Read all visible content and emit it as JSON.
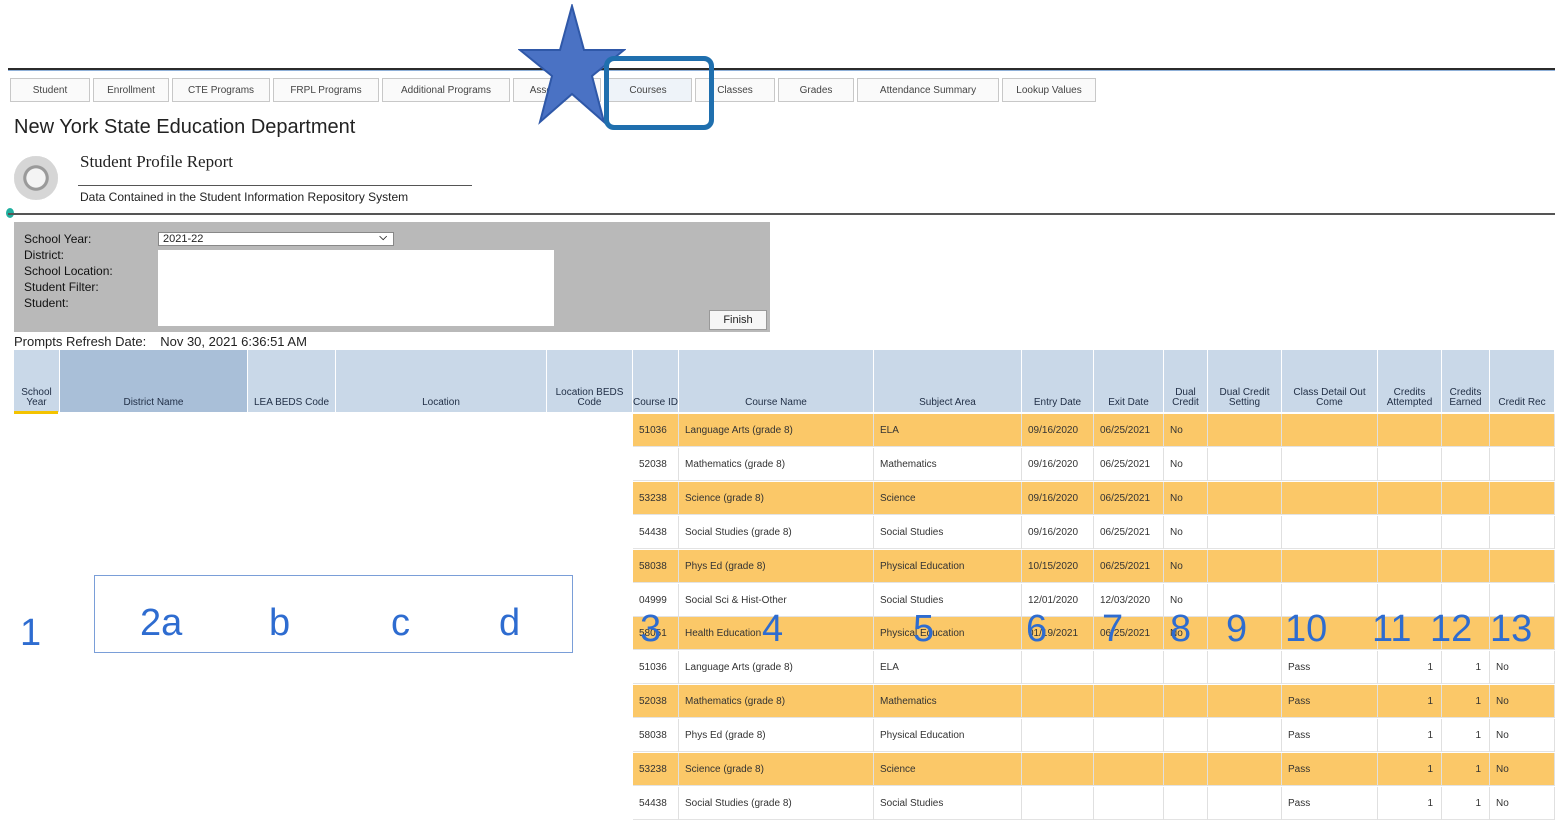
{
  "tabs": [
    "Student",
    "Enrollment",
    "CTE Programs",
    "FRPL Programs",
    "Additional Programs",
    "Assessment",
    "Courses",
    "Classes",
    "Grades",
    "Attendance Summary",
    "Lookup Values"
  ],
  "active_tab": "Courses",
  "org_title": "New York State Education Department",
  "report_title": "Student Profile Report",
  "report_subtitle": "Data Contained in the Student Information Repository System",
  "prompts": {
    "school_year_label": "School Year:",
    "school_year_value": "2021-22",
    "district_label": "District:",
    "school_location_label": "School Location:",
    "student_filter_label": "Student Filter:",
    "student_label": "Student:",
    "finish_label": "Finish"
  },
  "refresh": {
    "label": "Prompts Refresh Date:",
    "value": "Nov 30, 2021 6:36:51 AM"
  },
  "columns": [
    "School Year",
    "District Name",
    "LEA BEDS Code",
    "Location",
    "Location BEDS Code",
    "Course ID",
    "Course Name",
    "Subject Area",
    "Entry Date",
    "Exit Date",
    "Dual Credit",
    "Dual Credit Setting",
    "Class Detail Out Come",
    "Credits Attempted",
    "Credits Earned",
    "Credit Rec"
  ],
  "rows": [
    {
      "course_id": "51036",
      "course_name": "Language Arts (grade 8)",
      "subject": "ELA",
      "entry": "09/16/2020",
      "exit": "06/25/2021",
      "dual": "No",
      "outcome": "",
      "attempted": "",
      "earned": "",
      "rec": ""
    },
    {
      "course_id": "52038",
      "course_name": "Mathematics (grade 8)",
      "subject": "Mathematics",
      "entry": "09/16/2020",
      "exit": "06/25/2021",
      "dual": "No",
      "outcome": "",
      "attempted": "",
      "earned": "",
      "rec": ""
    },
    {
      "course_id": "53238",
      "course_name": "Science (grade 8)",
      "subject": "Science",
      "entry": "09/16/2020",
      "exit": "06/25/2021",
      "dual": "No",
      "outcome": "",
      "attempted": "",
      "earned": "",
      "rec": ""
    },
    {
      "course_id": "54438",
      "course_name": "Social Studies (grade 8)",
      "subject": "Social Studies",
      "entry": "09/16/2020",
      "exit": "06/25/2021",
      "dual": "No",
      "outcome": "",
      "attempted": "",
      "earned": "",
      "rec": ""
    },
    {
      "course_id": "58038",
      "course_name": "Phys Ed (grade 8)",
      "subject": "Physical Education",
      "entry": "10/15/2020",
      "exit": "06/25/2021",
      "dual": "No",
      "outcome": "",
      "attempted": "",
      "earned": "",
      "rec": ""
    },
    {
      "course_id": "04999",
      "course_name": "Social Sci & Hist-Other",
      "subject": "Social Studies",
      "entry": "12/01/2020",
      "exit": "12/03/2020",
      "dual": "No",
      "outcome": "",
      "attempted": "",
      "earned": "",
      "rec": ""
    },
    {
      "course_id": "58051",
      "course_name": "Health Education",
      "subject": "Physical Education",
      "entry": "01/19/2021",
      "exit": "06/25/2021",
      "dual": "No",
      "outcome": "",
      "attempted": "",
      "earned": "",
      "rec": ""
    },
    {
      "course_id": "51036",
      "course_name": "Language Arts (grade 8)",
      "subject": "ELA",
      "entry": "",
      "exit": "",
      "dual": "",
      "outcome": "Pass",
      "attempted": "1",
      "earned": "1",
      "rec": "No"
    },
    {
      "course_id": "52038",
      "course_name": "Mathematics (grade 8)",
      "subject": "Mathematics",
      "entry": "",
      "exit": "",
      "dual": "",
      "outcome": "Pass",
      "attempted": "1",
      "earned": "1",
      "rec": "No"
    },
    {
      "course_id": "58038",
      "course_name": "Phys Ed (grade 8)",
      "subject": "Physical Education",
      "entry": "",
      "exit": "",
      "dual": "",
      "outcome": "Pass",
      "attempted": "1",
      "earned": "1",
      "rec": "No"
    },
    {
      "course_id": "53238",
      "course_name": "Science (grade 8)",
      "subject": "Science",
      "entry": "",
      "exit": "",
      "dual": "",
      "outcome": "Pass",
      "attempted": "1",
      "earned": "1",
      "rec": "No"
    },
    {
      "course_id": "54438",
      "course_name": "Social Studies (grade 8)",
      "subject": "Social Studies",
      "entry": "",
      "exit": "",
      "dual": "",
      "outcome": "Pass",
      "attempted": "1",
      "earned": "1",
      "rec": "No"
    }
  ],
  "annotations": [
    "1",
    "2a",
    "b",
    "c",
    "d",
    "3",
    "4",
    "5",
    "6",
    "7",
    "8",
    "9",
    "10",
    "11",
    "12",
    "13"
  ],
  "colors": {
    "row_highlight": "#fbc868",
    "header_bg": "#c9d8e8",
    "annotation_blue": "#2e6cd0",
    "star_blue": "#4a72c4"
  }
}
